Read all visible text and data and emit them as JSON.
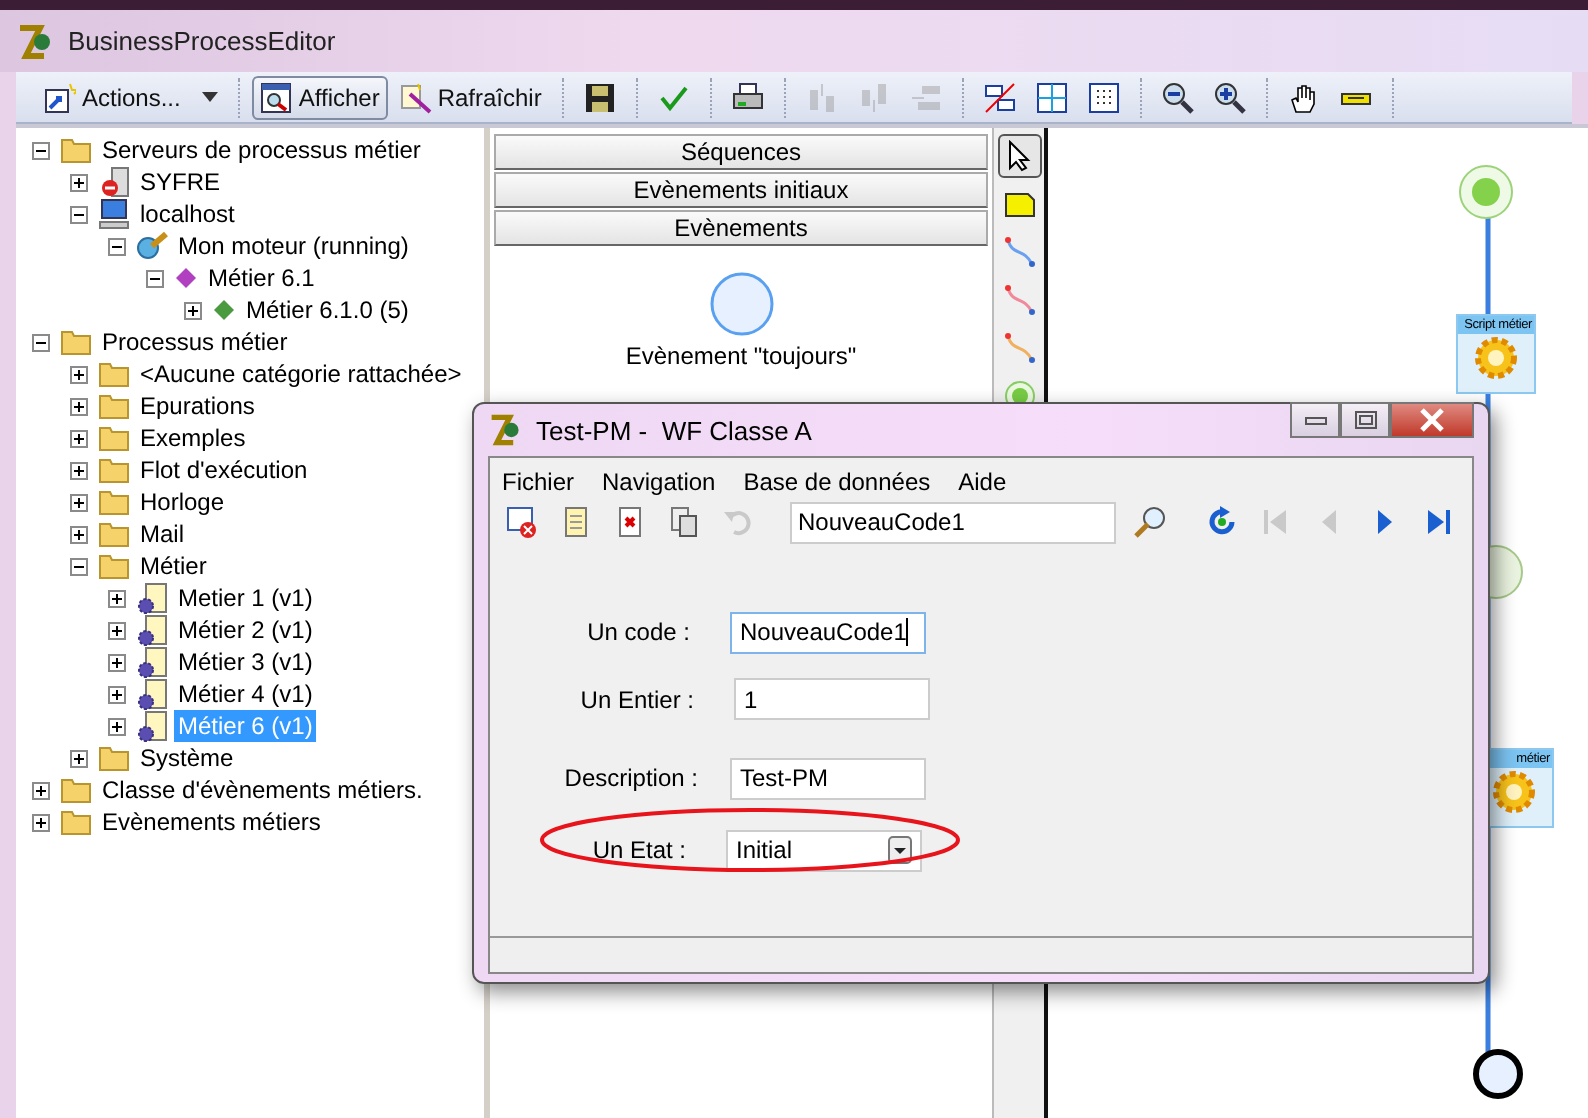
{
  "window": {
    "title": "BusinessProcessEditor"
  },
  "toolbar": {
    "groups": [
      [
        {
          "kind": "actions",
          "label": "Actions...",
          "disabled": false,
          "selected": false
        }
      ],
      [
        {
          "kind": "view",
          "label": "Afficher",
          "disabled": false,
          "selected": true
        },
        {
          "kind": "refresh",
          "label": "Rafraîchir",
          "disabled": false,
          "selected": false
        }
      ],
      [
        {
          "kind": "save",
          "disabled": false,
          "selected": false
        }
      ],
      [
        {
          "kind": "check",
          "disabled": false,
          "selected": false
        }
      ],
      [
        {
          "kind": "print",
          "disabled": false,
          "selected": false
        }
      ],
      [
        {
          "kind": "align-up",
          "disabled": true,
          "selected": false
        },
        {
          "kind": "align-down",
          "disabled": true,
          "selected": false
        },
        {
          "kind": "align-left",
          "disabled": true,
          "selected": false
        }
      ],
      [
        {
          "kind": "cross",
          "disabled": false,
          "selected": false
        },
        {
          "kind": "grid",
          "disabled": false,
          "selected": false
        },
        {
          "kind": "dots",
          "disabled": false,
          "selected": false
        }
      ],
      [
        {
          "kind": "zoom-out",
          "disabled": false,
          "selected": false
        },
        {
          "kind": "zoom-in",
          "disabled": false,
          "selected": false
        }
      ],
      [
        {
          "kind": "hand",
          "disabled": false,
          "selected": false
        },
        {
          "kind": "ruler",
          "disabled": false,
          "selected": false
        }
      ]
    ]
  },
  "tree": [
    {
      "label": "Serveurs de processus métier",
      "kind": "folder",
      "expanded": true,
      "selected": false,
      "children": [
        {
          "label": "SYFRE",
          "kind": "server",
          "expanded": false,
          "selected": false
        },
        {
          "label": "localhost",
          "kind": "computer",
          "expanded": true,
          "selected": false,
          "children": [
            {
              "label": "Mon moteur (running)",
              "kind": "engine",
              "expanded": true,
              "selected": false,
              "children": [
                {
                  "label": "Métier 6.1",
                  "kind": "diamond-purple",
                  "expanded": true,
                  "selected": false,
                  "children": [
                    {
                      "label": "Métier 6.1.0 (5)",
                      "kind": "diamond-green",
                      "expanded": false,
                      "selected": false
                    }
                  ]
                }
              ]
            }
          ]
        }
      ]
    },
    {
      "label": "Processus métier",
      "kind": "folder",
      "expanded": true,
      "selected": false,
      "children": [
        {
          "label": "<Aucune catégorie rattachée>",
          "kind": "folder",
          "expanded": false,
          "selected": false
        },
        {
          "label": "Epurations",
          "kind": "folder",
          "expanded": false,
          "selected": false
        },
        {
          "label": "Exemples",
          "kind": "folder",
          "expanded": false,
          "selected": false
        },
        {
          "label": "Flot d'exécution",
          "kind": "folder",
          "expanded": false,
          "selected": false
        },
        {
          "label": "Horloge",
          "kind": "folder",
          "expanded": false,
          "selected": false
        },
        {
          "label": "Mail",
          "kind": "folder",
          "expanded": false,
          "selected": false
        },
        {
          "label": "Métier",
          "kind": "folder",
          "expanded": true,
          "selected": false,
          "children": [
            {
              "label": "Metier 1 (v1)",
              "kind": "process",
              "expanded": false,
              "selected": false
            },
            {
              "label": "Métier 2 (v1)",
              "kind": "process",
              "expanded": false,
              "selected": false
            },
            {
              "label": "Métier 3 (v1)",
              "kind": "process",
              "expanded": false,
              "selected": false
            },
            {
              "label": "Métier 4 (v1)",
              "kind": "process",
              "expanded": false,
              "selected": false
            },
            {
              "label": "Métier 6 (v1)",
              "kind": "process",
              "expanded": false,
              "selected": true
            }
          ]
        },
        {
          "label": "Système",
          "kind": "folder",
          "expanded": false,
          "selected": false
        }
      ]
    },
    {
      "label": "Classe d'évènements métiers.",
      "kind": "folder",
      "expanded": false,
      "selected": false
    },
    {
      "label": "Evènements métiers",
      "kind": "folder",
      "expanded": false,
      "selected": false
    }
  ],
  "palette": {
    "sections": [
      "Séquences",
      "Evènements initiaux",
      "Evènements"
    ],
    "items": [
      {
        "label": "Evènement \"toujours\"",
        "kind": "event"
      }
    ]
  },
  "tools": [
    {
      "kind": "pointer",
      "selected": true
    },
    {
      "kind": "note",
      "selected": false
    },
    {
      "kind": "link-blue",
      "selected": false
    },
    {
      "kind": "link-red",
      "selected": false
    },
    {
      "kind": "link-orange",
      "selected": false
    },
    {
      "kind": "start",
      "selected": false
    }
  ],
  "canvas": {
    "nodes": [
      {
        "kind": "start"
      },
      {
        "kind": "script",
        "label": "Script métier"
      },
      {
        "kind": "event"
      },
      {
        "kind": "script",
        "label": "métier"
      },
      {
        "kind": "end"
      }
    ]
  },
  "dialog": {
    "title": "Test-PM -  WF Classe A",
    "menu": [
      "Fichier",
      "Navigation",
      "Base de données",
      "Aide"
    ],
    "search_value": "NouveauCode1",
    "tools_left": [
      {
        "kind": "close-record",
        "disabled": false
      },
      {
        "kind": "new",
        "disabled": false
      },
      {
        "kind": "delete",
        "disabled": false
      },
      {
        "kind": "copy",
        "disabled": false
      },
      {
        "kind": "undo",
        "disabled": true
      }
    ],
    "tools_right": [
      {
        "kind": "refresh",
        "disabled": false
      },
      {
        "kind": "first",
        "disabled": true
      },
      {
        "kind": "prev",
        "disabled": true
      },
      {
        "kind": "next",
        "disabled": false
      },
      {
        "kind": "last",
        "disabled": false
      }
    ],
    "fields": [
      {
        "label": "Un code :",
        "value": "NouveauCode1",
        "kind": "text",
        "focused": true,
        "highlighted": false
      },
      {
        "label": "Un Entier :",
        "value": "1",
        "kind": "text",
        "focused": false,
        "highlighted": false
      },
      {
        "label": "Description :",
        "value": "Test-PM",
        "kind": "text",
        "focused": false,
        "highlighted": false
      },
      {
        "label": "Un Etat :",
        "value": "Initial",
        "kind": "select",
        "focused": false,
        "highlighted": true
      }
    ]
  }
}
